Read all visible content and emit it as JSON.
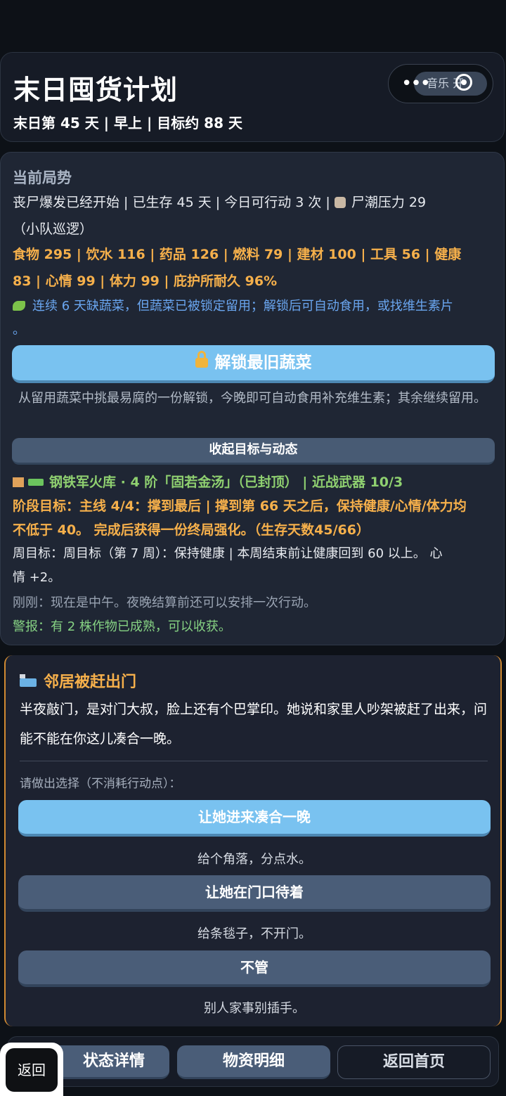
{
  "header": {
    "title": "末日囤货计划",
    "day_line": "末日第 45 天 | 早上 | 目标约 88 天",
    "music_label": "音乐 开"
  },
  "status": {
    "section_title": "当前局势",
    "line1": "丧尸爆发已经开始 | 已生存 45 天 | 今日可行动 3 次 | ",
    "zombie_icon": "zombie-icon",
    "line1_tail": "尸潮压力 29",
    "line2": "（小队巡逻）",
    "resources_line1": "食物 295 | 饮水 116 | 药品 126 | 燃料 79 | 建材 100 | 工具 56 | 健康",
    "resources_line2": "83 | 心情 99 | 体力 99 | 庇护所耐久 96%",
    "veg_warning_line1": "连续 6 天缺蔬菜，但蔬菜已被锁定留用；解锁后可自动食用，或找维生素片",
    "veg_warning_line2": "。",
    "unlock_button": "解锁最旧蔬菜",
    "unlock_desc": "从留用蔬菜中挑最易腐的一份解锁，今晚即可自动食用补充维生素；其余继续留用。",
    "collapse_button": "收起目标与动态",
    "armory_line": "钢铁军火库 · 4 阶「固若金汤」（已封顶） | 近战武器 10/3",
    "stage_goal_line1": "阶段目标：主线 4/4：撑到最后 | 撑到第 66 天之后，保持健康/心情/体力均",
    "stage_goal_line2": "不低于 40。 完成后获得一份终局强化。（生存天数45/66）",
    "weekly_line1": "周目标：周目标（第 7 周）：保持健康 | 本周结束前让健康回到 60 以上。 心",
    "weekly_line2": "情 +2。",
    "recent_line": "刚刚：现在是中午。夜晚结算前还可以安排一次行动。",
    "alert_line": "警报：有 2 株作物已成熟，可以收获。"
  },
  "event": {
    "title": "邻居被赶出门",
    "text": "半夜敲门，是对门大叔，脸上还有个巴掌印。她说和家里人吵架被赶了出来，问能不能在你这儿凑合一晚。",
    "hint": "请做出选择（不消耗行动点）：",
    "choices": [
      {
        "label": "让她进来凑合一晚",
        "desc": "给个角落，分点水。"
      },
      {
        "label": "让她在门口待着",
        "desc": "给条毯子，不开门。"
      },
      {
        "label": "不管",
        "desc": "别人家事别插手。"
      }
    ]
  },
  "bottom_nav": {
    "status_detail": "状态详情",
    "supplies": "物资明细",
    "home": "返回首页"
  },
  "back_button": "返回"
}
